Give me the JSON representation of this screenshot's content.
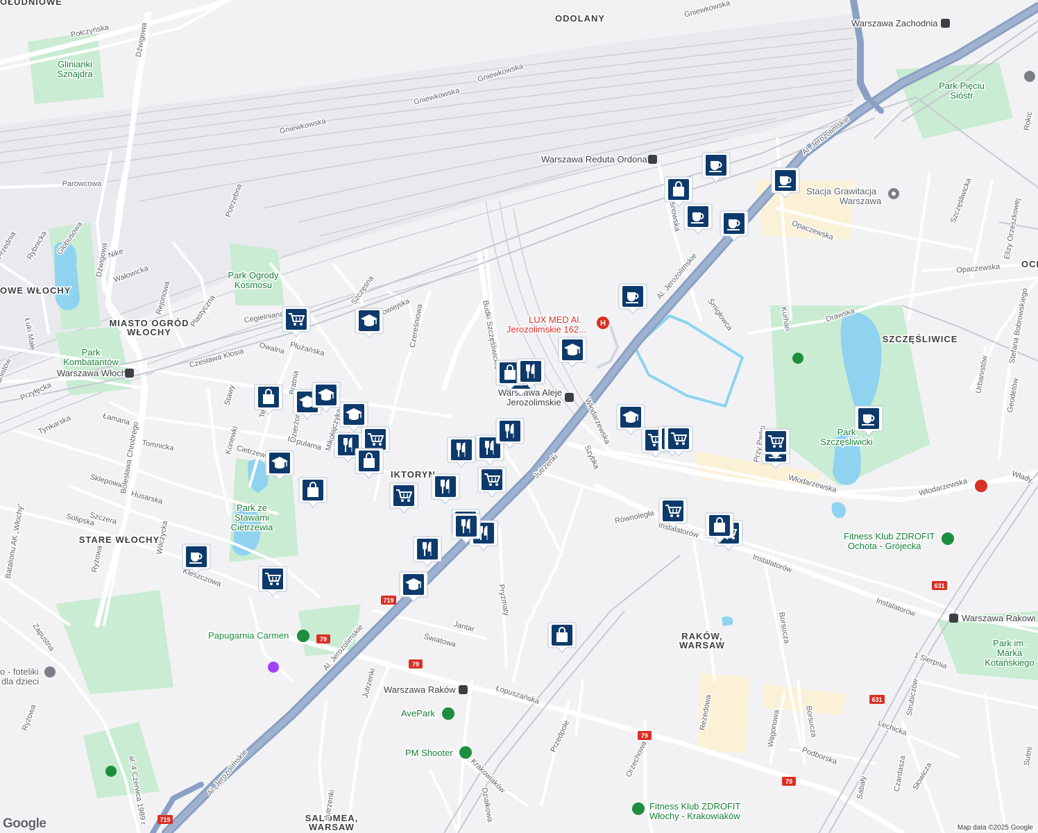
{
  "map": {
    "attribution": "Map data ©2025 Google",
    "logo": "Google",
    "colors": {
      "background": "#f2f2f4",
      "park": "#c9ecd2",
      "water": "#8fd3f1",
      "highway": "#8aa0c3",
      "rail": "#c6c9cf",
      "road": "#ffffff",
      "marker": "#0d3a6b",
      "hospital": "#d93025"
    }
  },
  "districts": [
    {
      "id": "odolany",
      "text": "ODOLANY"
    },
    {
      "id": "ogw",
      "text": "OWE WŁOCHY"
    },
    {
      "id": "mow1",
      "text": "MIASTO OGRÓD"
    },
    {
      "id": "mow2",
      "text": "WŁOCHY"
    },
    {
      "id": "stare",
      "text": "STARE WŁOCHY"
    },
    {
      "id": "wiktoryn",
      "text": "IKTORYN"
    },
    {
      "id": "rakow1",
      "text": "RAKÓW,"
    },
    {
      "id": "rakow2",
      "text": "WARSAW"
    },
    {
      "id": "szcz",
      "text": "SZCZĘŚLIWICE"
    },
    {
      "id": "salomea1",
      "text": "SALOMEA,"
    },
    {
      "id": "salomea2",
      "text": "WARSAW"
    },
    {
      "id": "poludniowe",
      "text": "OŁUDNIOWE"
    },
    {
      "id": "ochota",
      "text": "OCH"
    }
  ],
  "parks": [
    {
      "id": "glinianki1",
      "text": "Glinianki"
    },
    {
      "id": "glinianki2",
      "text": "Sznajdra"
    },
    {
      "id": "ogrody1",
      "text": "Park Ogrody"
    },
    {
      "id": "ogrody2",
      "text": "Kosmosu"
    },
    {
      "id": "komb1",
      "text": "Park"
    },
    {
      "id": "komb2",
      "text": "Kombatantów"
    },
    {
      "id": "stawy1",
      "text": "Park ze"
    },
    {
      "id": "stawy2",
      "text": "Stawami"
    },
    {
      "id": "stawy3",
      "text": "Cietrzewia"
    },
    {
      "id": "piec1",
      "text": "Park Pięciu"
    },
    {
      "id": "piec2",
      "text": "Sióstr"
    },
    {
      "id": "szczp1",
      "text": "Park"
    },
    {
      "id": "szczp2",
      "text": "Szczęśliwicki"
    },
    {
      "id": "kot1",
      "text": "Park im."
    },
    {
      "id": "kot2",
      "text": "Marka"
    },
    {
      "id": "kot3",
      "text": "Kotańskiego"
    }
  ],
  "stations": [
    {
      "id": "zachodnia",
      "text": "Warszawa Zachodnia"
    },
    {
      "id": "reduta",
      "text": "Warszawa Reduta Ordona"
    },
    {
      "id": "wlochy",
      "text": "Warszawa Włochy"
    },
    {
      "id": "aleje1",
      "text": "Warszawa Aleje"
    },
    {
      "id": "aleje2",
      "text": "Jerozolimskie"
    },
    {
      "id": "rakow",
      "text": "Warszawa Raków"
    },
    {
      "id": "rakowiecka",
      "text": "Warszawa Rakowi"
    }
  ],
  "pois": [
    {
      "id": "luxmed1",
      "text": "LUX MED Al."
    },
    {
      "id": "luxmed2",
      "text": "Jerozolimskie 162..."
    },
    {
      "id": "grawitacja1",
      "text": "Stacja Grawitacja"
    },
    {
      "id": "grawitacja2",
      "text": "Warszawa"
    },
    {
      "id": "papugarnia",
      "text": "Papugarnia Carmen"
    },
    {
      "id": "avepark",
      "text": "AvePark"
    },
    {
      "id": "pmshooter",
      "text": "PM Shooter"
    },
    {
      "id": "fit1a",
      "text": "Fitness Klub ZDROFIT"
    },
    {
      "id": "fit1b",
      "text": "Ochota - Grójecka"
    },
    {
      "id": "fit2a",
      "text": "Fitness Klub ZDROFIT"
    },
    {
      "id": "fit2b",
      "text": "Włochy - Krakowiaków"
    },
    {
      "id": "fotel1",
      "text": "o - foteliki"
    },
    {
      "id": "fotel2",
      "text": "dla dzieci"
    }
  ],
  "streets": [
    "Połczyńska",
    "Dźwigowa",
    "Gniewkowska",
    "Gniewkowska",
    "Gniewkowska",
    "Gniewkowska",
    "Parowcowa",
    "Potrzebna",
    "Przednia",
    "Rybnicka",
    "Globusowa",
    "Dźwigowa",
    "Nike",
    "Wałowicka",
    "Rejonowa",
    "Plastyczna",
    "Szczęsna",
    "Jarowiejska",
    "Czereśniowa",
    "Cegielniana",
    "Płużańska",
    "Owalna",
    "Czesława Kłosia",
    "Łuki Małe",
    "Pianistów",
    "Przyłęcka",
    "Tynkarska",
    "Łamana",
    "Tomnicka",
    "Sklepowa",
    "Husarska",
    "Solipska",
    "Szczera",
    "Bolesława Chrobrego",
    "Konewki",
    "Cietrzewia",
    "Stawy",
    "Popularna",
    "Wilczycka",
    "Kleszczowa",
    "Ryżowa",
    "Zapustna",
    "Ryżowa",
    "Batalionu AK „Włochy”",
    "Al. Jerozolimskie",
    "Al. Jerozolimskie",
    "Al. Jerozolimskie",
    "Al. Jerozolimskie",
    "Budki Szczęśliwickie",
    "Włodarzewska",
    "Szybka",
    "Jutrzenki",
    "Jutrzenki",
    "Jutrzenki",
    "Pryzmaty",
    "Jantar",
    "Światowa",
    "Łopuszańska",
    "Przedpole",
    "Działkowa",
    "Krakowiaków",
    "Orzechowa",
    "Rezedowa",
    "Wagonowa",
    "Borsucza",
    "Borsucza",
    "Podborska",
    "Równoległa",
    "Instalatorów",
    "Instalatorów",
    "Instalatorów",
    "Włodarzewska",
    "Włodarzewska",
    "Kurhan",
    "Drawska",
    "Śmigłowca",
    "Opaczewska",
    "Opaczewska",
    "Szczęśliwicka",
    "Elizy Orzeszkowej",
    "Stefana Bobrowskiego",
    "Urbanistów",
    "Geodetów",
    "Przy Parku",
    "1 Sierpnia",
    "Lechicka",
    "Strubiczów",
    "Czardasza",
    "Słowicza",
    "Sabały",
    "Sulmi",
    "Szczęsnowska",
    "Włady",
    "Rokic",
    "al. 4 Czerwca 1989 r.",
    "Mikołajczyka",
    "Dzierżoniowska",
    "Bratnia",
    "Teligi"
  ],
  "route_shields": [
    "719",
    "79",
    "79",
    "79",
    "79",
    "631",
    "631",
    "719"
  ],
  "markers": [
    {
      "type": "cafe",
      "icon": "coffee-cup-icon"
    },
    {
      "type": "cafe",
      "icon": "coffee-cup-icon"
    },
    {
      "type": "shopping",
      "icon": "shopping-bag-icon"
    },
    {
      "type": "cafe",
      "icon": "coffee-cup-icon"
    },
    {
      "type": "cafe",
      "icon": "coffee-cup-icon"
    },
    {
      "type": "cafe",
      "icon": "coffee-cup-icon"
    },
    {
      "type": "education",
      "icon": "graduation-cap-icon"
    },
    {
      "type": "grocery",
      "icon": "shopping-cart-icon"
    },
    {
      "type": "education",
      "icon": "graduation-cap-icon"
    },
    {
      "type": "restaurant",
      "icon": "fork-knife-icon"
    },
    {
      "type": "shopping",
      "icon": "shopping-bag-icon"
    },
    {
      "type": "shopping",
      "icon": "shopping-bag-icon"
    },
    {
      "type": "education",
      "icon": "graduation-cap-icon"
    },
    {
      "type": "education",
      "icon": "graduation-cap-icon"
    },
    {
      "type": "education",
      "icon": "graduation-cap-icon"
    },
    {
      "type": "grocery",
      "icon": "shopping-cart-icon"
    },
    {
      "type": "restaurant",
      "icon": "fork-knife-icon"
    },
    {
      "type": "shopping",
      "icon": "shopping-bag-icon"
    },
    {
      "type": "education",
      "icon": "graduation-cap-icon"
    },
    {
      "type": "shopping",
      "icon": "shopping-bag-icon"
    },
    {
      "type": "restaurant",
      "icon": "fork-knife-icon"
    },
    {
      "type": "restaurant",
      "icon": "fork-knife-icon"
    },
    {
      "type": "restaurant",
      "icon": "fork-knife-icon"
    },
    {
      "type": "restaurant",
      "icon": "fork-knife-icon"
    },
    {
      "type": "grocery",
      "icon": "shopping-cart-icon"
    },
    {
      "type": "grocery",
      "icon": "shopping-cart-icon"
    },
    {
      "type": "restaurant",
      "icon": "fork-knife-icon"
    },
    {
      "type": "restaurant",
      "icon": "fork-knife-icon"
    },
    {
      "type": "restaurant",
      "icon": "fork-knife-icon"
    },
    {
      "type": "education",
      "icon": "graduation-cap-icon"
    },
    {
      "type": "cafe",
      "icon": "coffee-cup-icon"
    },
    {
      "type": "grocery",
      "icon": "shopping-cart-icon"
    },
    {
      "type": "shopping",
      "icon": "shopping-bag-icon"
    },
    {
      "type": "education",
      "icon": "graduation-cap-icon"
    },
    {
      "type": "grocery",
      "icon": "shopping-cart-icon"
    },
    {
      "type": "grocery",
      "icon": "shopping-cart-icon"
    },
    {
      "type": "grocery",
      "icon": "shopping-cart-icon"
    },
    {
      "type": "grocery",
      "icon": "shopping-cart-icon"
    },
    {
      "type": "cafe",
      "icon": "coffee-cup-icon"
    },
    {
      "type": "cafe",
      "icon": "coffee-cup-icon"
    },
    {
      "type": "grocery",
      "icon": "shopping-cart-icon"
    },
    {
      "type": "grocery",
      "icon": "shopping-cart-icon"
    },
    {
      "type": "shopping",
      "icon": "shopping-bag-icon"
    },
    {
      "type": "shopping",
      "icon": "shopping-bag-icon"
    },
    {
      "type": "restaurant",
      "icon": "fork-knife-icon"
    }
  ]
}
